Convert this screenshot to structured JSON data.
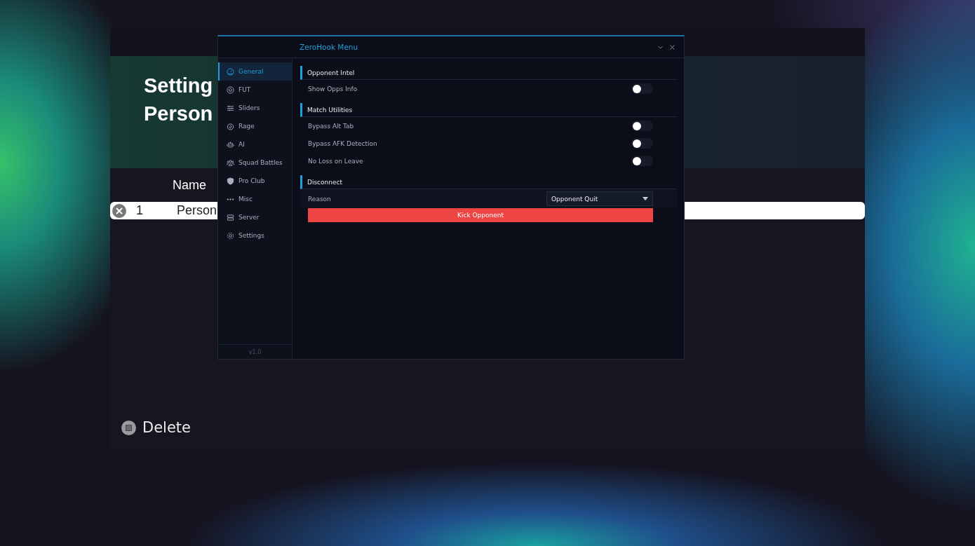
{
  "game_screen": {
    "title_lines": [
      "Setting",
      "Person"
    ],
    "column_header": "Name",
    "rows": [
      {
        "index": "1",
        "name": "Person",
        "selected": true
      }
    ],
    "footer_action": "Delete"
  },
  "menu": {
    "title": "ZeroHook Menu",
    "version": "v1.0",
    "sidebar": [
      {
        "label": "General",
        "selected": true
      },
      {
        "label": "FUT",
        "selected": false
      },
      {
        "label": "Sliders",
        "selected": false
      },
      {
        "label": "Rage",
        "selected": false
      },
      {
        "label": "AI",
        "selected": false
      },
      {
        "label": "Squad Battles",
        "selected": false
      },
      {
        "label": "Pro Club",
        "selected": false
      },
      {
        "label": "Misc",
        "selected": false
      },
      {
        "label": "Server",
        "selected": false
      },
      {
        "label": "Settings",
        "selected": false
      }
    ],
    "sections": [
      {
        "title": "Opponent Intel",
        "items": [
          {
            "kind": "toggle",
            "label": "Show Opps Info",
            "on": false
          }
        ]
      },
      {
        "title": "Match Utilities",
        "items": [
          {
            "kind": "toggle",
            "label": "Bypass Alt Tab",
            "on": false
          },
          {
            "kind": "toggle",
            "label": "Bypass AFK Detection",
            "on": false
          },
          {
            "kind": "toggle",
            "label": "No Loss on Leave",
            "on": false
          }
        ]
      },
      {
        "title": "Disconnect",
        "items": [
          {
            "kind": "select",
            "label": "Reason",
            "value": "Opponent Quit"
          },
          {
            "kind": "button",
            "label": "Kick Opponent"
          }
        ]
      }
    ]
  }
}
